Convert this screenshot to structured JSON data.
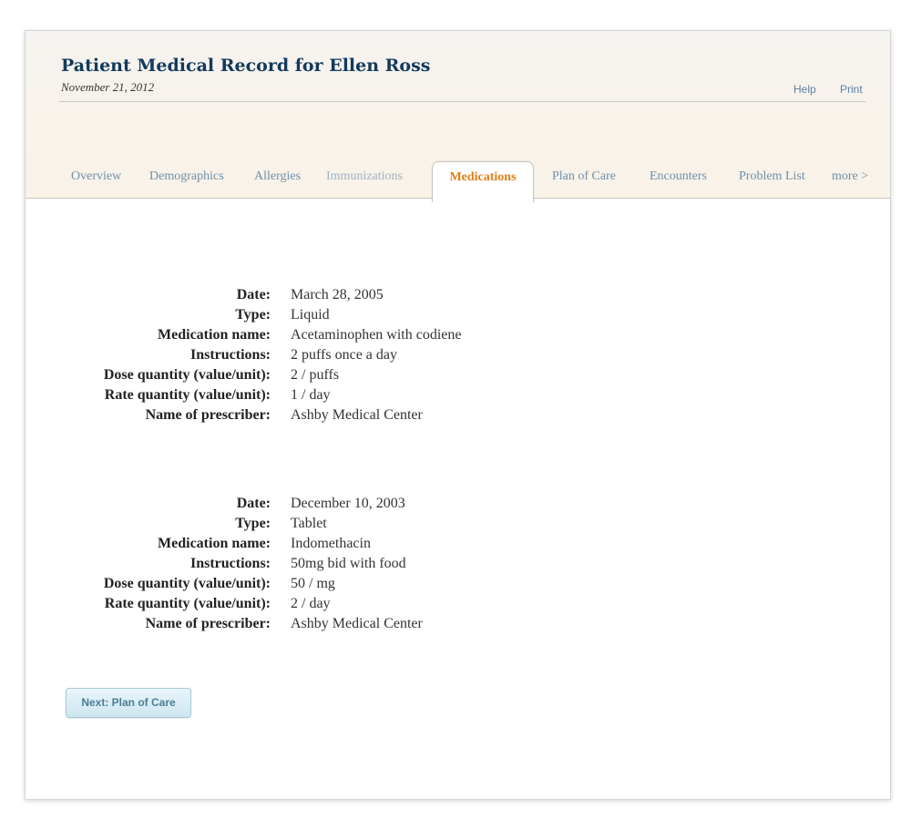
{
  "header": {
    "title": "Patient Medical Record for Ellen Ross",
    "date": "November 21, 2012",
    "links": {
      "help": "Help",
      "print": "Print"
    }
  },
  "tabs": {
    "overview": "Overview",
    "demographics": "Demographics",
    "allergies": "Allergies",
    "immunizations": "Immunizations",
    "medications": "Medications",
    "plan_of_care": "Plan of Care",
    "encounters": "Encounters",
    "problem_list": "Problem List",
    "more": "more >"
  },
  "labels": {
    "date": "Date:",
    "type": "Type:",
    "medication_name": "Medication name:",
    "instructions": "Instructions:",
    "dose_quantity": "Dose quantity (value/unit):",
    "rate_quantity": "Rate quantity (value/unit):",
    "prescriber": "Name of prescriber:"
  },
  "medications": [
    {
      "date": "March 28, 2005",
      "type": "Liquid",
      "medication_name": "Acetaminophen with codiene",
      "instructions": "2 puffs once a day",
      "dose_quantity": "2 / puffs",
      "rate_quantity": "1 / day",
      "prescriber": "Ashby Medical Center"
    },
    {
      "date": "December 10, 2003",
      "type": "Tablet",
      "medication_name": "Indomethacin",
      "instructions": "50mg bid with food",
      "dose_quantity": "50 / mg",
      "rate_quantity": "2 / day",
      "prescriber": "Ashby Medical Center"
    }
  ],
  "next_button": "Next: Plan of Care",
  "colors": {
    "title": "#123a5c",
    "active_tab": "#e07f17",
    "tab": "#6e8fac",
    "button_text": "#4a7d96"
  }
}
